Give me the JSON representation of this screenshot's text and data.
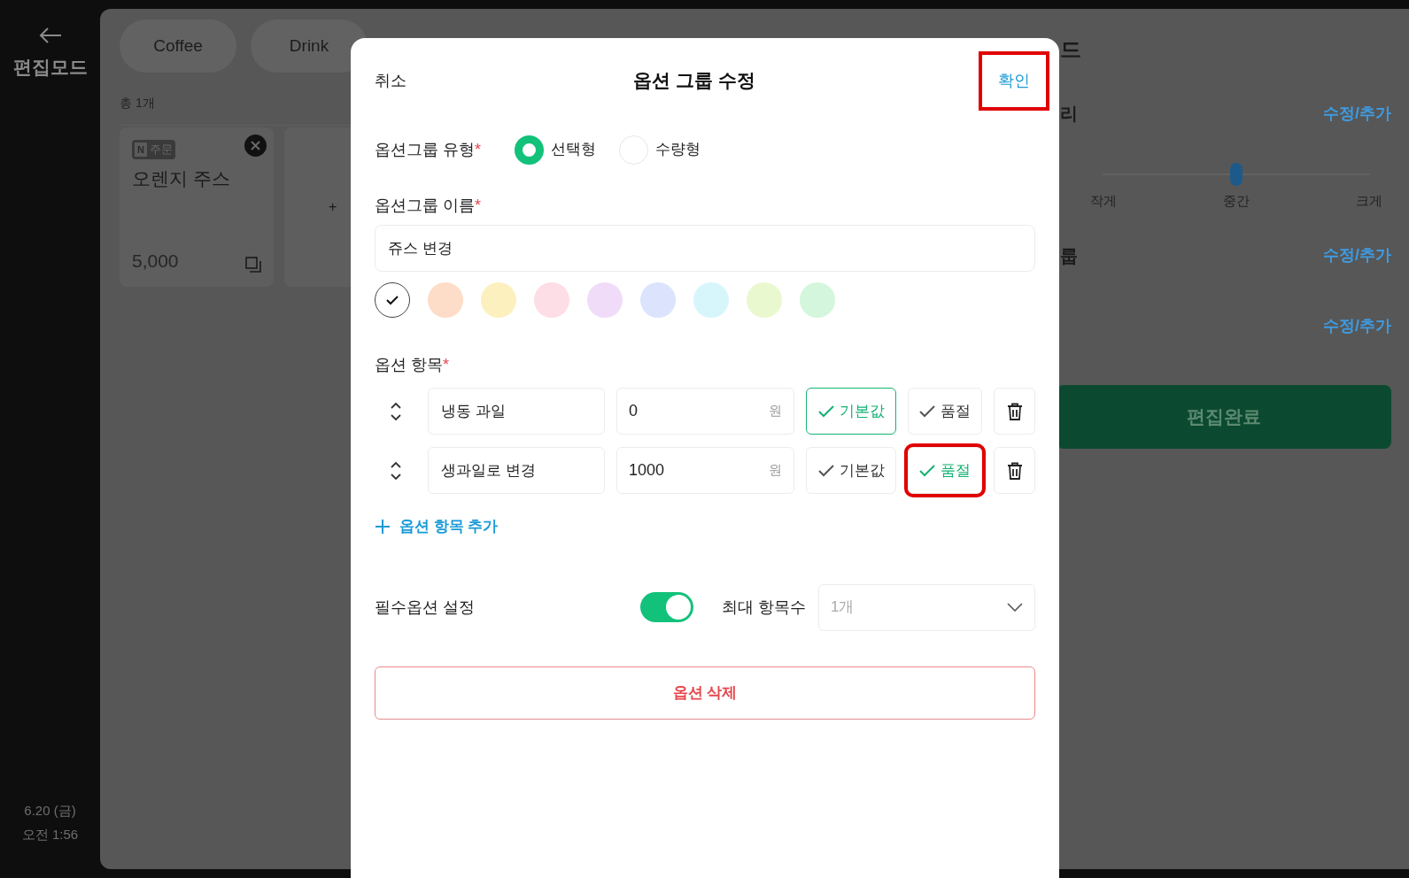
{
  "sidebar": {
    "title": "편집모드",
    "date": "6.20 (금)",
    "time": "오전 1:56"
  },
  "category_tabs": [
    {
      "label": "Coffee"
    },
    {
      "label": "Drink"
    }
  ],
  "product_count": "총 1개",
  "products": [
    {
      "badge_letter": "N",
      "badge_label": "주문",
      "name": "오렌지 주스",
      "price": "5,000"
    }
  ],
  "add_card": {
    "label": "+"
  },
  "right_panel": {
    "title": "드",
    "sections": [
      {
        "kind": "link",
        "label": "리",
        "action": "수정/추가"
      },
      {
        "kind": "slider",
        "labels": [
          "작게",
          "중간",
          "크게"
        ],
        "level": 0.5
      },
      {
        "kind": "link",
        "label": "룹",
        "action": "수정/추가"
      },
      {
        "kind": "link",
        "action": "수정/추가"
      }
    ],
    "done_button": "편집완료"
  },
  "modal": {
    "cancel": "취소",
    "title": "옵션 그룹 수정",
    "confirm": {
      "label": "확인",
      "highlighted": true
    },
    "type_field": {
      "label": "옵션그룹 유형",
      "mark": "*",
      "options": [
        {
          "label": "선택형",
          "selected": true
        },
        {
          "label": "수량형",
          "selected": false
        }
      ]
    },
    "name_field": {
      "label": "옵션그룹 이름",
      "mark": "*",
      "value": "쥬스 변경"
    },
    "color_swatches": [
      {
        "color": "#ffffff",
        "selected": true
      },
      {
        "color": "#fddcc8",
        "selected": false
      },
      {
        "color": "#fdf0bf",
        "selected": false
      },
      {
        "color": "#fddde6",
        "selected": false
      },
      {
        "color": "#f0dcf8",
        "selected": false
      },
      {
        "color": "#dbe4fc",
        "selected": false
      },
      {
        "color": "#d6f6fb",
        "selected": false
      },
      {
        "color": "#eaf8cf",
        "selected": false
      },
      {
        "color": "#d4f6dc",
        "selected": false
      }
    ],
    "items_field": {
      "label": "옵션 항목",
      "mark": "*",
      "items": [
        {
          "name": "냉동 과일",
          "price": "0",
          "currency": "원",
          "default": {
            "label": "기본값",
            "checked": true,
            "highlighted": false
          },
          "sold_out": {
            "label": "품절",
            "checked": false,
            "highlighted": false
          }
        },
        {
          "name": "생과일로 변경",
          "price": "1000",
          "currency": "원",
          "default": {
            "label": "기본값",
            "checked": false,
            "highlighted": false
          },
          "sold_out": {
            "label": "품절",
            "checked": true,
            "highlighted": true
          }
        }
      ],
      "add_label": "옵션 항목 추가"
    },
    "required_option": {
      "label": "필수옵션 설정",
      "on": true
    },
    "max_items": {
      "label": "최대 항목수",
      "value": "1개"
    },
    "delete_button": "옵션 삭제"
  }
}
